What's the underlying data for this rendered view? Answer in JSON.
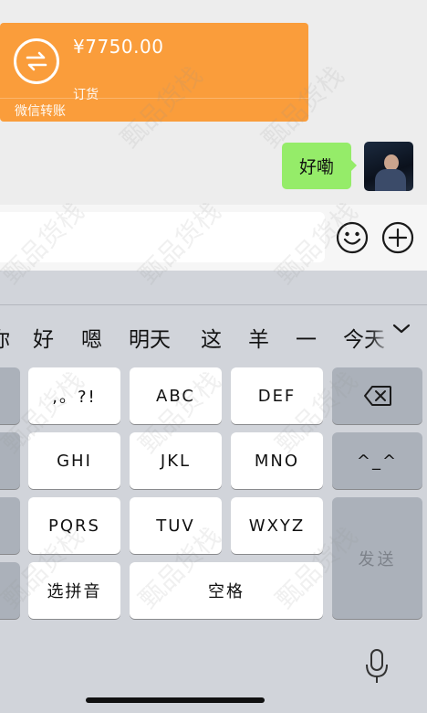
{
  "transfer": {
    "amount": "¥7750.00",
    "note": "订货",
    "label": "微信转账",
    "color": "#fa9d3b"
  },
  "reply": {
    "text": "好嘞",
    "color": "#95ec69"
  },
  "input_bar": {
    "value": "",
    "emoji_icon": "smiley-face-icon",
    "plus_icon": "plus-circle-icon"
  },
  "keyboard": {
    "candidates": [
      "你",
      "好",
      "嗯",
      "明天",
      "这",
      "羊",
      "一",
      "今天"
    ],
    "keys": {
      "punct": ",。?!",
      "abc": "ABC",
      "def": "DEF",
      "ghi": "GHI",
      "jkl": "JKL",
      "mno": "MNO",
      "pqrs": "PQRS",
      "tuv": "TUV",
      "wxyz": "WXYZ",
      "pinyin": "选拼音",
      "space": "空格",
      "send": "发送",
      "emoticon": "^_^"
    },
    "icons": [
      "chevron-down-icon",
      "backspace-icon",
      "microphone-icon"
    ]
  },
  "watermark_text": "甄品货栈"
}
